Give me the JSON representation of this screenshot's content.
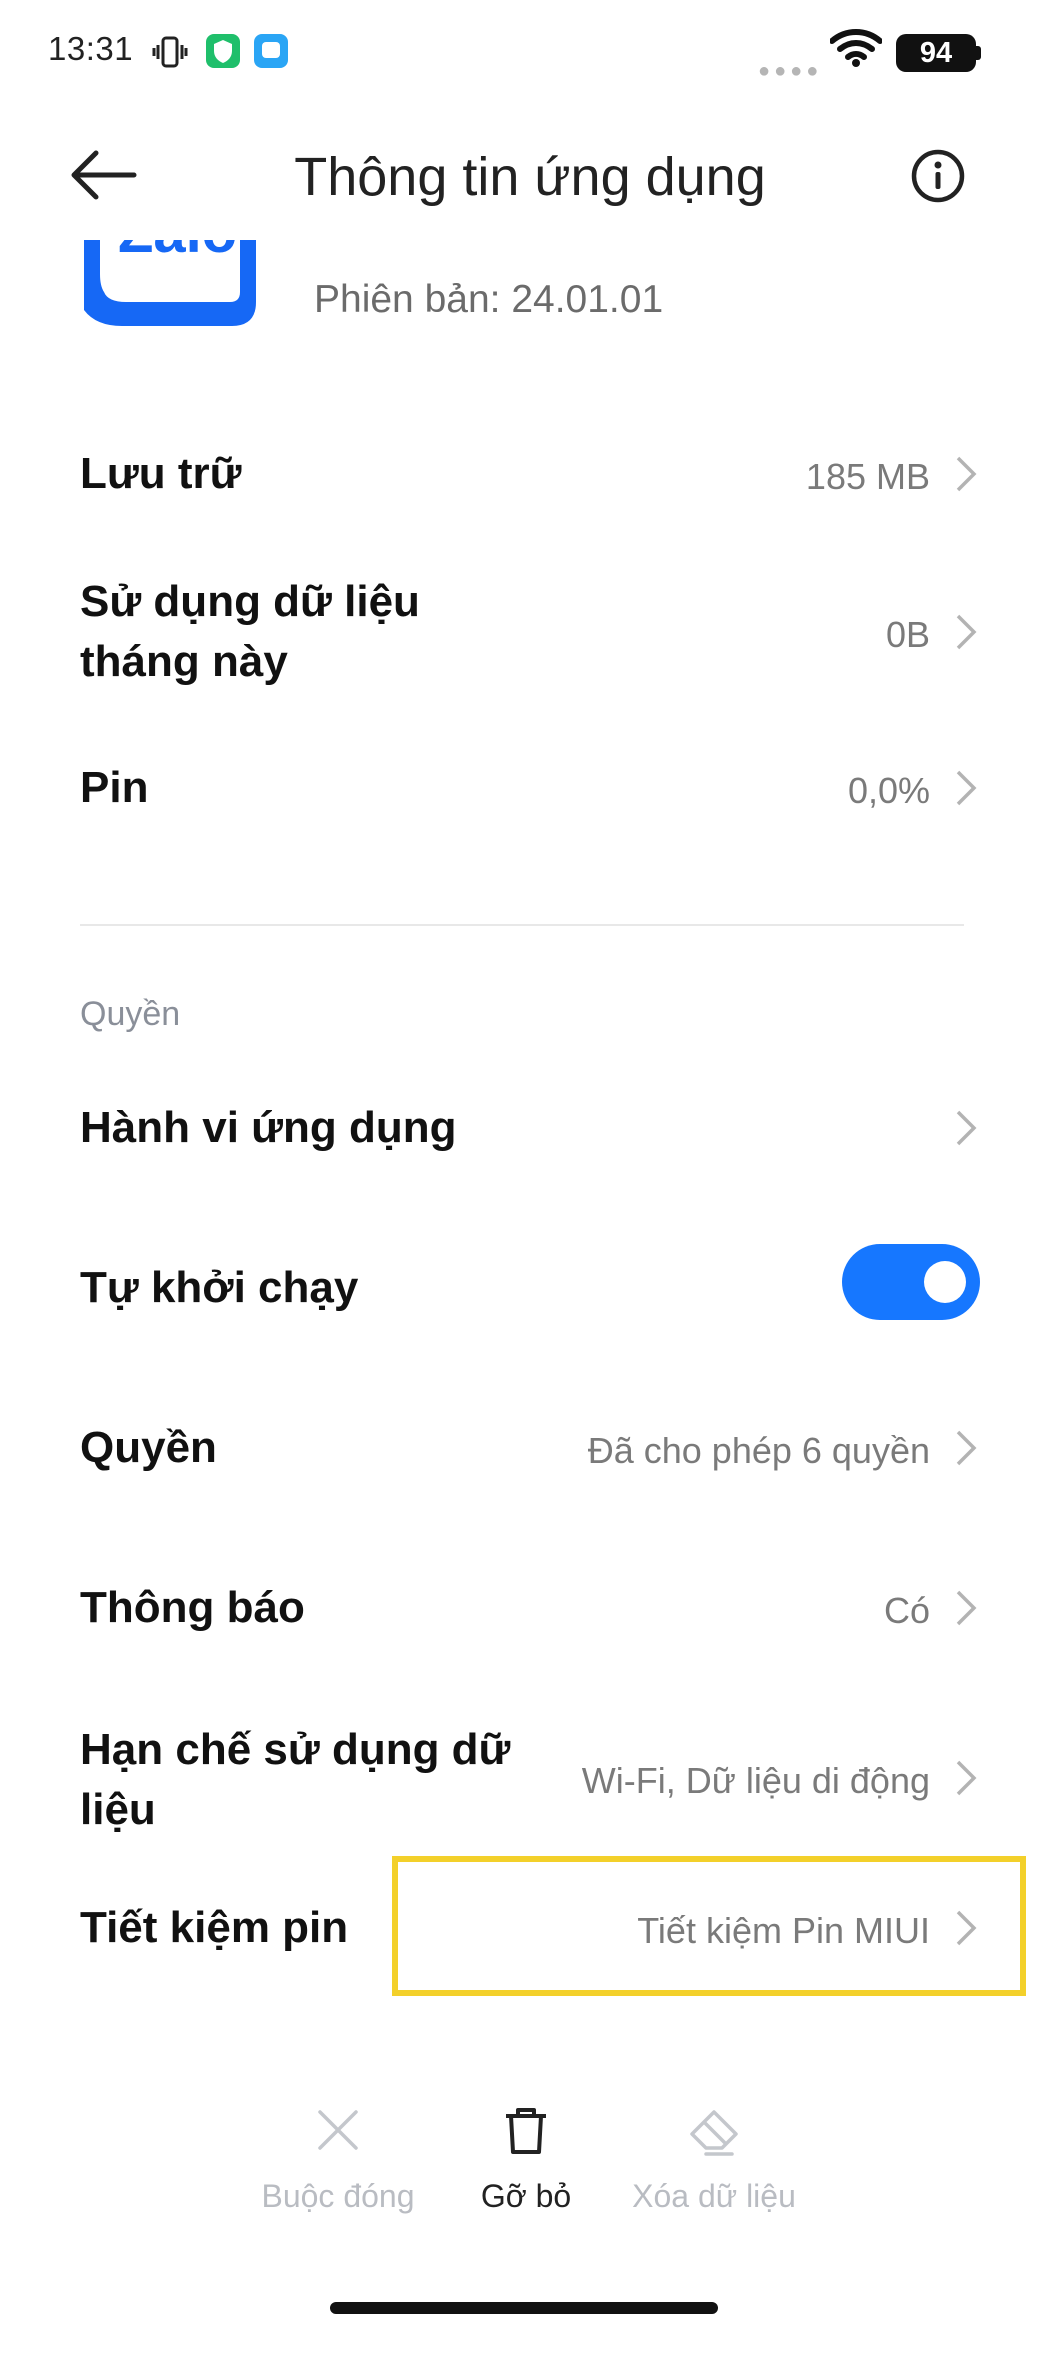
{
  "status_bar": {
    "time": "13:31",
    "battery": "94",
    "icons": [
      "vibrate-icon",
      "shield-app-icon",
      "message-app-icon",
      "signal-dots-icon",
      "wifi-icon"
    ]
  },
  "header": {
    "title": "Thông tin ứng dụng",
    "back_icon": "arrow-left-icon",
    "info_icon": "info-circle-icon"
  },
  "app": {
    "logo_text": "Zalo",
    "version": "Phiên bản: 24.01.01"
  },
  "usage_rows": [
    {
      "label": "Lưu trữ",
      "value": "185 MB"
    },
    {
      "label_line1": "Sử dụng dữ liệu",
      "label_line2": "tháng này",
      "value": "0B"
    },
    {
      "label": "Pin",
      "value": "0,0%"
    }
  ],
  "permissions": {
    "section_title": "Quyền",
    "rows": [
      {
        "label": "Hành vi ứng dụng",
        "value": ""
      },
      {
        "label": "Tự khởi chạy",
        "toggle": true
      },
      {
        "label": "Quyền",
        "value": "Đã cho phép 6 quyền"
      },
      {
        "label": "Thông báo",
        "value": "Có"
      },
      {
        "label_line1": "Hạn chế sử dụng dữ",
        "label_line2": "liệu",
        "value": "Wi-Fi, Dữ liệu di động"
      },
      {
        "label": "Tiết kiệm pin",
        "value": "Tiết kiệm Pin MIUI"
      }
    ]
  },
  "highlight_color": "#f3d02a",
  "accent_color": "#1677ff",
  "bottom_bar": {
    "force_stop": "Buộc đóng",
    "uninstall": "Gỡ bỏ",
    "clear_data": "Xóa dữ liệu"
  }
}
